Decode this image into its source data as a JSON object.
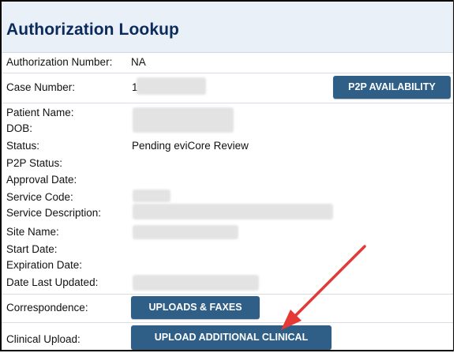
{
  "page": {
    "title": "Authorization Lookup"
  },
  "fields": {
    "authorization_number": {
      "label": "Authorization Number:",
      "value": "NA"
    },
    "case_number": {
      "label": "Case Number:",
      "value": "1"
    },
    "patient_name": {
      "label": "Patient Name:",
      "value": ""
    },
    "dob": {
      "label": "DOB:",
      "value": ""
    },
    "status": {
      "label": "Status:",
      "value": "Pending eviCore Review"
    },
    "p2p_status": {
      "label": "P2P Status:",
      "value": ""
    },
    "approval_date": {
      "label": "Approval Date:",
      "value": ""
    },
    "service_code": {
      "label": "Service Code:",
      "value": ""
    },
    "service_description": {
      "label": "Service Description:",
      "value": ""
    },
    "site_name": {
      "label": "Site Name:",
      "value": ""
    },
    "start_date": {
      "label": "Start Date:",
      "value": ""
    },
    "expiration_date": {
      "label": "Expiration Date:",
      "value": ""
    },
    "date_last_updated": {
      "label": "Date Last Updated:",
      "value": ""
    },
    "correspondence": {
      "label": "Correspondence:"
    },
    "clinical_upload": {
      "label": "Clinical Upload:"
    }
  },
  "buttons": {
    "p2p_availability": "P2P AVAILABILITY",
    "uploads_faxes": "UPLOADS & FAXES",
    "upload_additional_clinical": "UPLOAD ADDITIONAL CLINICAL"
  },
  "colors": {
    "title": "#0b2b5c",
    "header_bg": "#eaf0f7",
    "button_bg": "#2f5f86",
    "arrow": "#e53935"
  },
  "icons": {
    "annotation": "red-arrow-icon"
  }
}
